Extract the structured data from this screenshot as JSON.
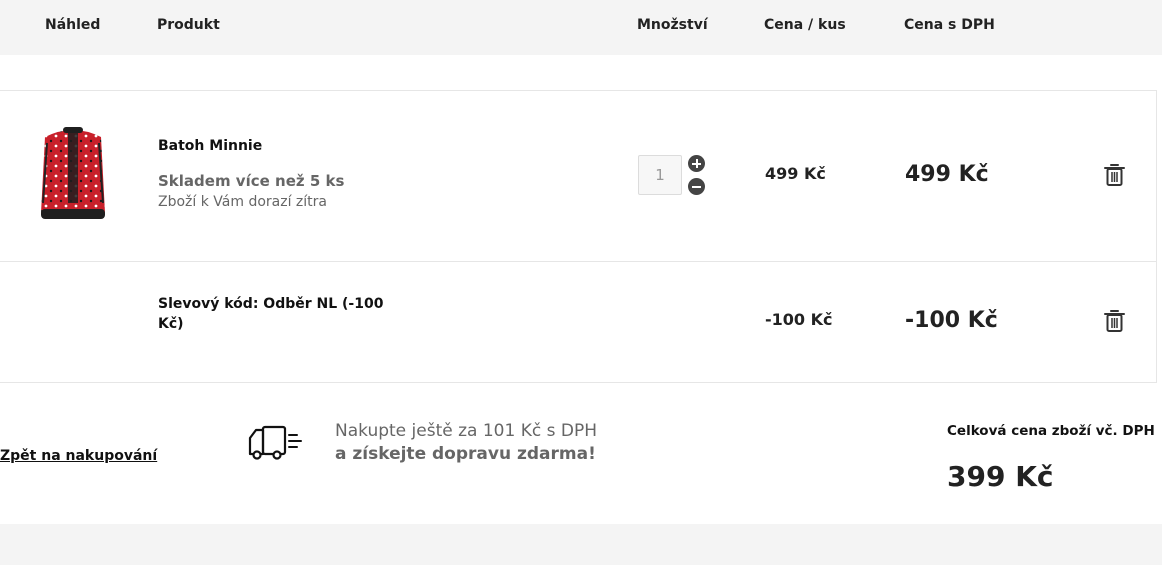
{
  "columns": {
    "preview": "Náhled",
    "product": "Produkt",
    "quantity": "Množství",
    "unit_price": "Cena / kus",
    "price_vat": "Cena s DPH"
  },
  "items": [
    {
      "name": "Batoh Minnie",
      "stock": "Skladem více než 5 ks",
      "delivery": "Zboží k Vám dorazí zítra",
      "quantity": "1",
      "unit_price": "499 Kč",
      "total": "499 Kč",
      "thumbnail": "red Minnie backpack with white polka dots",
      "icons": {
        "increase": "plus-circle-icon",
        "decrease": "minus-circle-icon",
        "remove": "trash-icon"
      }
    },
    {
      "name": "Slevový kód: Odběr NL (-100 Kč)",
      "unit_price": "-100 Kč",
      "total": "-100 Kč",
      "icons": {
        "remove": "trash-icon"
      }
    }
  ],
  "footer": {
    "back_link": "Zpět na nakupování",
    "shipping_icon": "delivery-truck-icon",
    "shipping_line1": "Nakupte ještě za 101 Kč s DPH",
    "shipping_line2": "a získejte dopravu zdarma!",
    "total_label": "Celková cena zboží vč. DPH",
    "total_value": "399 Kč"
  },
  "colors": {
    "header_bg": "#f4f4f4",
    "muted_text": "#666666",
    "backpack_red": "#c8202a"
  }
}
